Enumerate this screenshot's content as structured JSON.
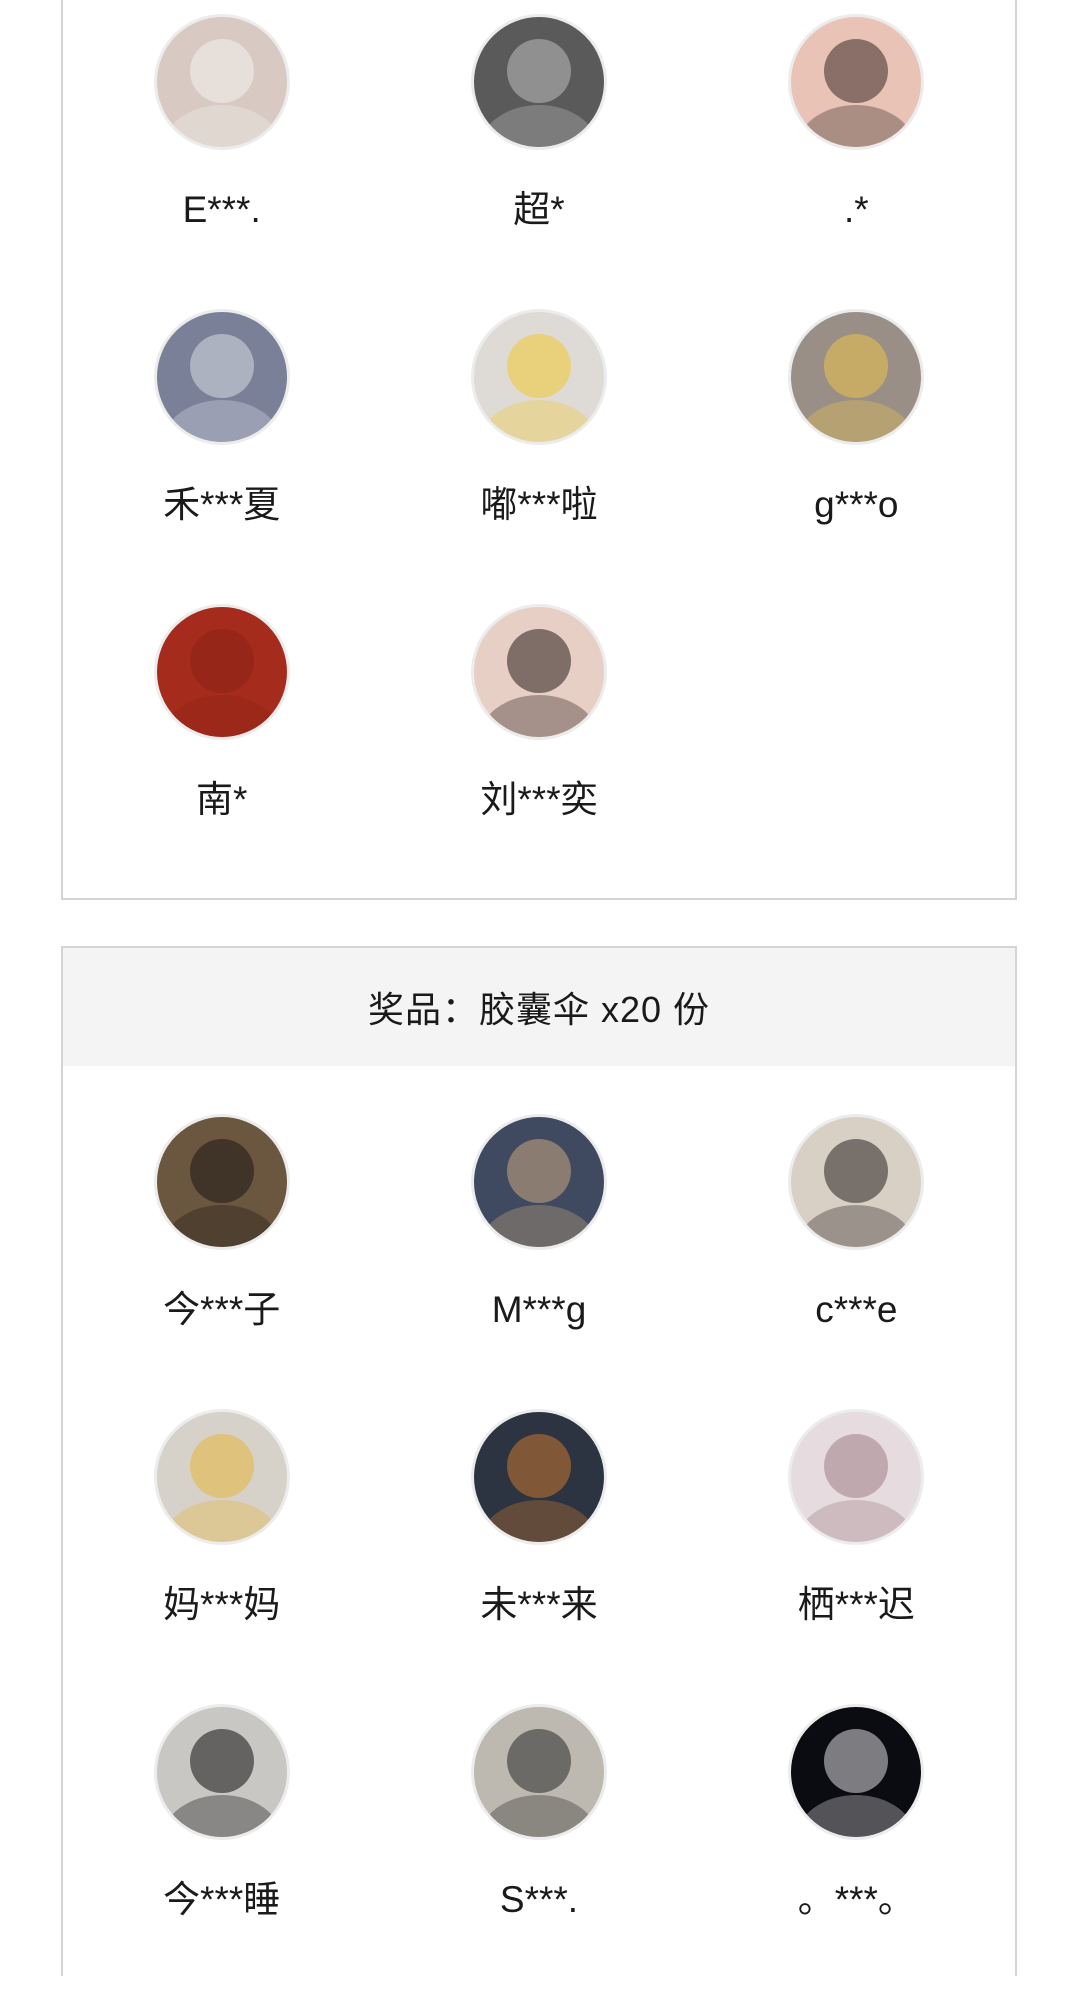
{
  "sections": [
    {
      "header": "",
      "winners": [
        {
          "name": "E***.",
          "avatar_bg": "#d8c9c2",
          "avatar_accent": "#f2f0ee"
        },
        {
          "name": "超*",
          "avatar_bg": "#5a5a5a",
          "avatar_accent": "#bdbdbd"
        },
        {
          "name": ".*",
          "avatar_bg": "#e9c3b5",
          "avatar_accent": "#3a2a26"
        },
        {
          "name": "禾***夏",
          "avatar_bg": "#7a8098",
          "avatar_accent": "#d7dae4"
        },
        {
          "name": "嘟***啦",
          "avatar_bg": "#dedbd7",
          "avatar_accent": "#f3c92f"
        },
        {
          "name": "g***o",
          "avatar_bg": "#9a8f86",
          "avatar_accent": "#e9c24a"
        },
        {
          "name": "南*",
          "avatar_bg": "#a52b1c",
          "avatar_accent": "#8a2215"
        },
        {
          "name": "刘***奕",
          "avatar_bg": "#e7cfc6",
          "avatar_accent": "#2a1d1a"
        }
      ]
    },
    {
      "header": "奖品：胶囊伞 x20 份",
      "winners": [
        {
          "name": "今***子",
          "avatar_bg": "#6b5640",
          "avatar_accent": "#1e1714"
        },
        {
          "name": "M***g",
          "avatar_bg": "#3f4a60",
          "avatar_accent": "#c8a57f"
        },
        {
          "name": "c***e",
          "avatar_bg": "#d8d0c5",
          "avatar_accent": "#2a2220"
        },
        {
          "name": "妈***妈",
          "avatar_bg": "#d6d1c9",
          "avatar_accent": "#e8b63a"
        },
        {
          "name": "未***来",
          "avatar_bg": "#2c3442",
          "avatar_accent": "#c9772f"
        },
        {
          "name": "栖***迟",
          "avatar_bg": "#e6dcdf",
          "avatar_accent": "#a07e86"
        },
        {
          "name": "今***睡",
          "avatar_bg": "#c9c7c4",
          "avatar_accent": "#111111"
        },
        {
          "name": "S***.",
          "avatar_bg": "#bdb8b0",
          "avatar_accent": "#2a2a2a"
        },
        {
          "name": "。***。",
          "avatar_bg": "#0b0b12",
          "avatar_accent": "#dcdcdc"
        }
      ]
    }
  ]
}
